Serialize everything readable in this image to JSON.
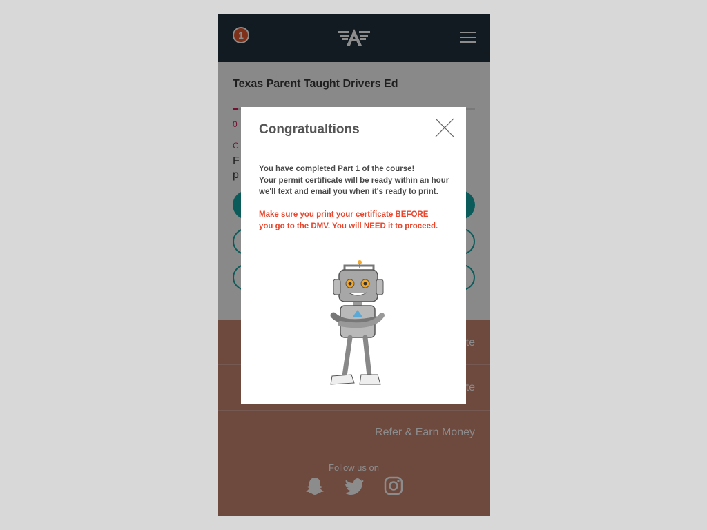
{
  "header": {
    "notification_count": "1",
    "logo": "wings-a-logo-icon",
    "menu": "hamburger-menu-icon",
    "bg_color": "#22303f"
  },
  "course": {
    "title": "Texas Parent Taught Drivers Ed",
    "progress_text": "0",
    "progress": 0.02,
    "chapter_label": "C",
    "chapter_text_line1": "F",
    "chapter_text_line2": "p"
  },
  "footer": {
    "links": [
      "te",
      "te",
      "Refer & Earn Money"
    ],
    "follow_label": "Follow us on",
    "social": [
      "snapchat-icon",
      "twitter-icon",
      "instagram-icon"
    ]
  },
  "modal": {
    "title": "Congratualtions",
    "message_lines": [
      "You have completed Part 1 of the course!",
      "Your permit certificate will be ready within an hour",
      "we'll text and email  you when it's ready to print."
    ],
    "warning_lines": [
      "Make sure you print your certificate BEFORE",
      "you go to the DMV. You will NEED it to proceed."
    ],
    "image": "robot-mascot-icon",
    "accent_color": "#e8472d"
  }
}
